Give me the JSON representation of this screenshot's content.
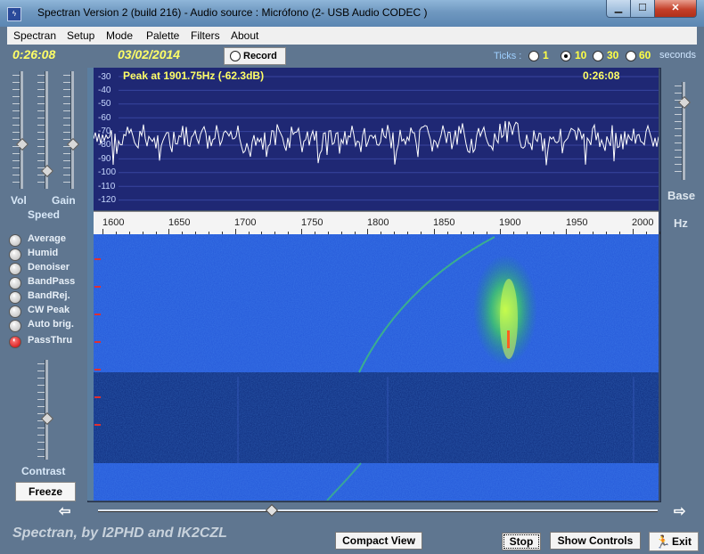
{
  "window": {
    "title": "Spectran Version 2 (build 216) - Audio source  :  Micrófono (2- USB Audio CODEC )",
    "minimize": "▁",
    "maximize": "☐",
    "close": "✕"
  },
  "menu": [
    "Spectran",
    "Setup",
    "Mode",
    "Palette",
    "Filters",
    "About"
  ],
  "controls": {
    "time": "0:26:08",
    "date": "03/02/2014",
    "record_label": "Record",
    "ticks_label": "Ticks :",
    "ticks": [
      {
        "value": "1",
        "selected": false
      },
      {
        "value": "10",
        "selected": true
      },
      {
        "value": "30",
        "selected": false
      },
      {
        "value": "60",
        "selected": false
      }
    ],
    "ticks_unit": "seconds"
  },
  "left_panel": {
    "vol_label": "Vol",
    "gain_label": "Gain",
    "speed_label": "Speed",
    "contrast_label": "Contrast",
    "freeze_label": "Freeze",
    "options": [
      {
        "label": "Average",
        "active": false
      },
      {
        "label": "Humid",
        "active": false
      },
      {
        "label": "Denoiser",
        "active": false
      },
      {
        "label": "BandPass",
        "active": false
      },
      {
        "label": "BandRej.",
        "active": false
      },
      {
        "label": "CW Peak",
        "active": false
      },
      {
        "label": "Auto brig.",
        "active": false
      },
      {
        "label": "PassThru",
        "active": true
      }
    ]
  },
  "spectrum": {
    "peak_text": "Peak at  1901.75Hz (-62.3dB)",
    "time": "0:26:08",
    "db_labels": [
      "-30",
      "-40",
      "-50",
      "-60",
      "-70",
      "-80",
      "-90",
      "-100",
      "-110",
      "-120"
    ]
  },
  "freq_axis": {
    "labels": [
      "1600",
      "1650",
      "1700",
      "1750",
      "1800",
      "1850",
      "1900",
      "1950",
      "2000"
    ]
  },
  "right_panel": {
    "base_label": "Base",
    "hz_label": "Hz"
  },
  "bottom": {
    "credit": "Spectran, by I2PHD and IK2CZL",
    "compact_view": "Compact View",
    "stop": "Stop",
    "show_controls": "Show Controls",
    "exit": "Exit"
  },
  "colors": {
    "spectrum_bg": "#1f2874",
    "waterfall_bg": "#1f4ecf",
    "label_yellow": "#ffff66"
  }
}
